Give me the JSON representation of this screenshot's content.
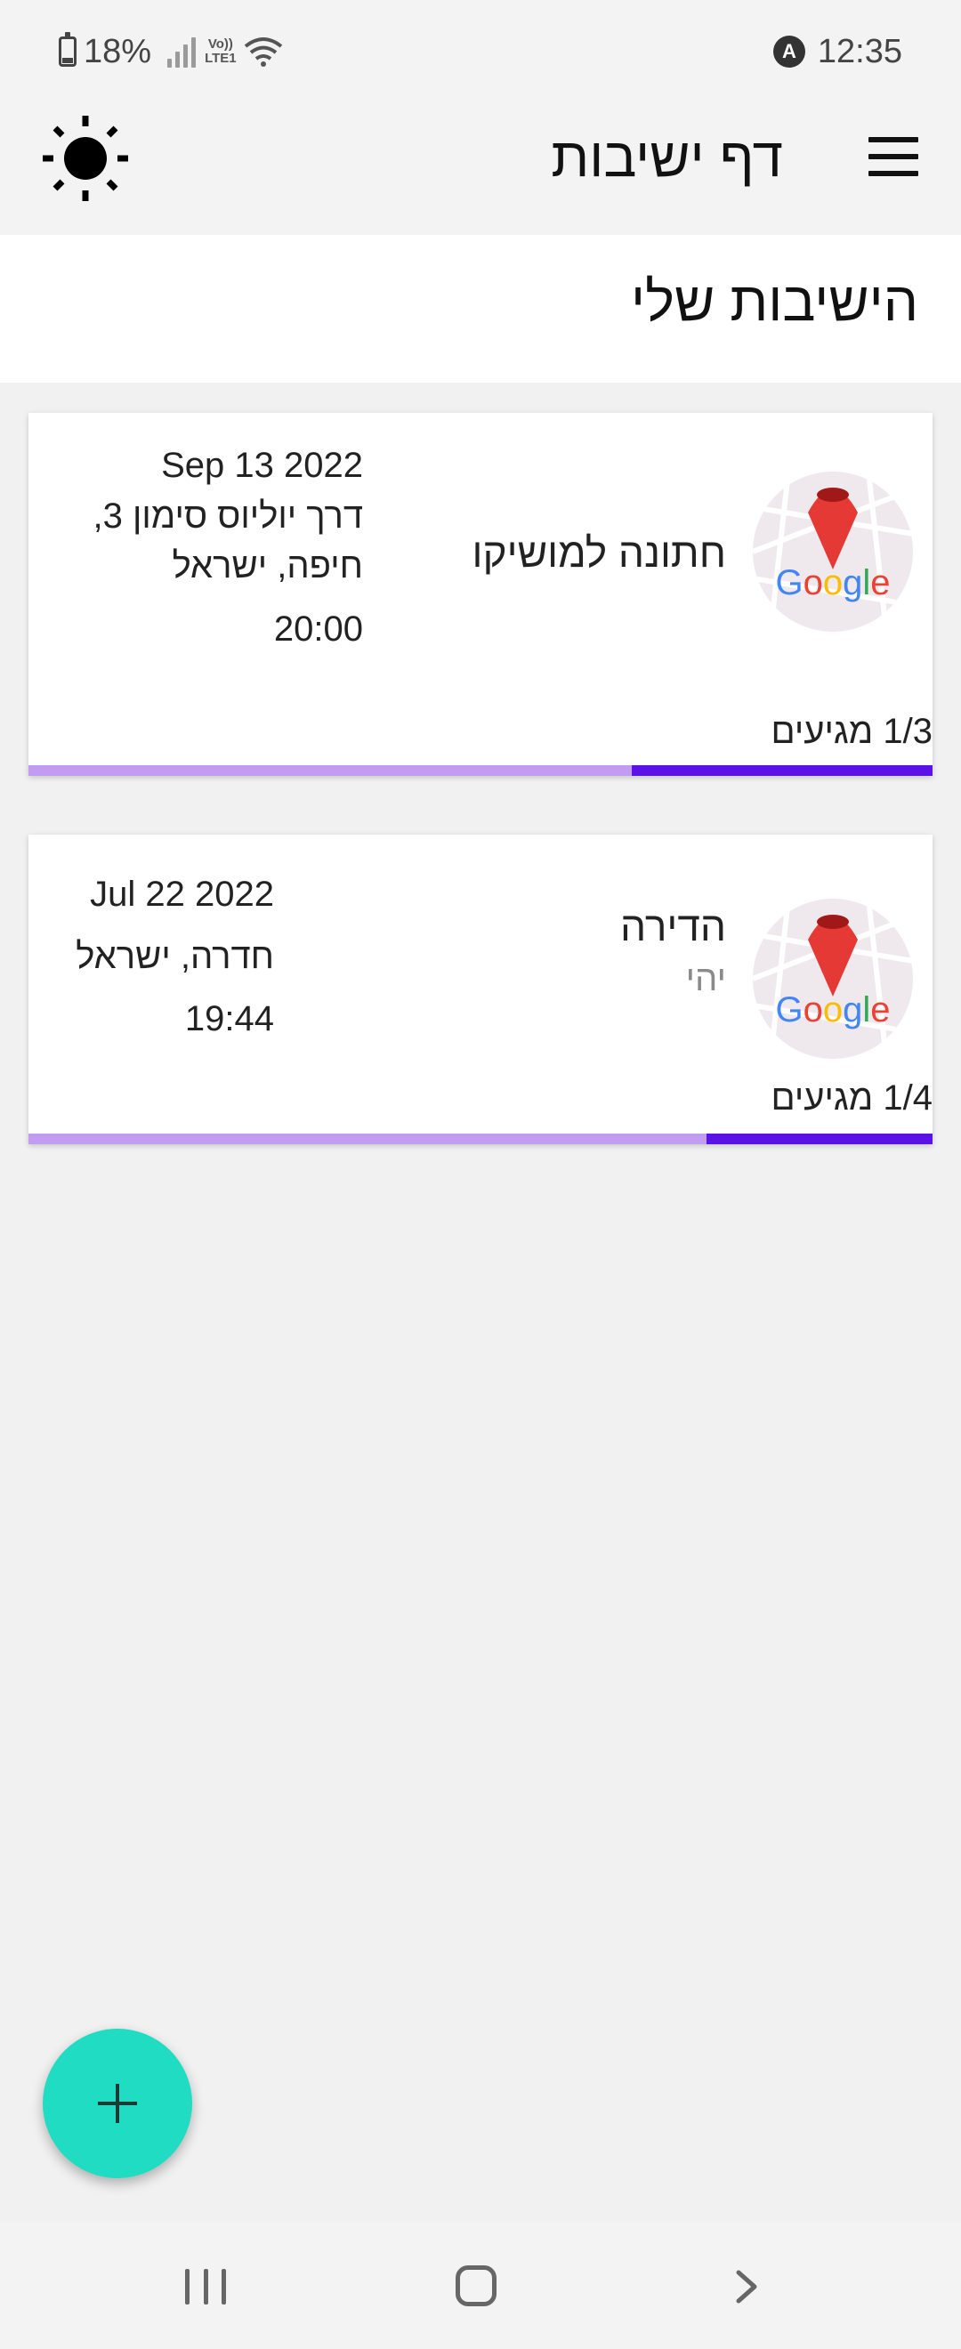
{
  "status_bar": {
    "battery": "18%",
    "network_type": "Vo)) LTE1",
    "time": "12:35",
    "notification_badge": "A"
  },
  "app_bar": {
    "title": "דף ישיבות",
    "left_icon": "brightness-icon",
    "right_icon": "menu-icon"
  },
  "section": {
    "title": "הישיבות שלי"
  },
  "meetings": [
    {
      "title": "חתונה למושיקו",
      "subtitle": "",
      "date": "Sep 13 2022",
      "location_line1": "דרך יוליוס סימון 3,",
      "location_line2": "חיפה, ישראל",
      "time": "20:00",
      "arrivals": "1/3 מגיעים",
      "progress": 0.333
    },
    {
      "title": "הדירה",
      "subtitle": "יהי",
      "date": "Jul 22 2022",
      "location_line1": "חדרה, ישראל",
      "location_line2": "",
      "time": "19:44",
      "arrivals": "1/4 מגיעים",
      "progress": 0.25
    }
  ],
  "map_logo_text": "Google",
  "fab": {
    "icon": "plus-icon"
  },
  "nav_bar": {
    "icons": [
      "recents-icon",
      "home-icon",
      "back-icon"
    ]
  },
  "colors": {
    "fab": "#1fdcc2",
    "progress_fill": "#5b12e6",
    "progress_track": "#c29cf0",
    "pin": "#e53935"
  }
}
